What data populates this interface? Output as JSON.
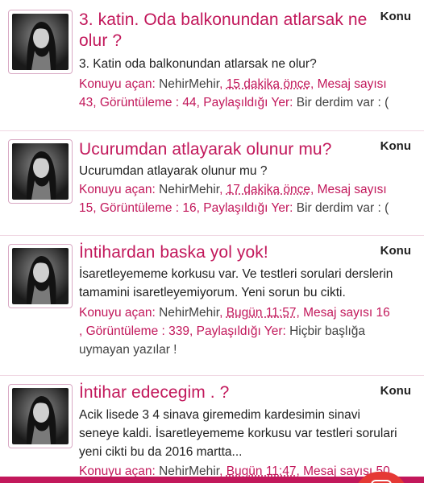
{
  "posts": [
    {
      "title_line1": "3. katin. Oda balkonundan atlarsak ne",
      "title_line2": "olur ?",
      "badge": "Konu",
      "snippet": "3. Katin oda balkonundan atlarsak ne olur?",
      "meta": {
        "opener_label": "Konuyu açan: ",
        "opener_name": "NehirMehir",
        "sep": ", ",
        "time": "15 dakika önce",
        "msg_label": ", Mesaj sayısı",
        "msg_count": "43",
        "views_label": ", Görüntüleme : ",
        "views": "44",
        "share_label": ", Paylaşıldığı Yer: ",
        "share_place": "Bir derdim var : ("
      }
    },
    {
      "title_line1": "Ucurumdan atlayarak olunur mu?",
      "badge": "Konu",
      "snippet": "Ucurumdan atlayarak olunur mu ?",
      "meta": {
        "opener_label": "Konuyu açan: ",
        "opener_name": "NehirMehir",
        "sep": ", ",
        "time": "17 dakika önce",
        "msg_label": ", Mesaj sayısı",
        "msg_count": "15",
        "views_label": ", Görüntüleme : ",
        "views": "16",
        "share_label": ", Paylaşıldığı Yer: ",
        "share_place": "Bir derdim var : ("
      }
    },
    {
      "title_line1": "İntihardan baska yol yok!",
      "badge": "Konu",
      "snippet_line1": "İsaretleyememe korkusu var. Ve testleri sorulari derslerin",
      "snippet_line2": "tamamini isaretleyemiyorum. Yeni sorun bu cikti.",
      "meta": {
        "opener_label": "Konuyu açan: ",
        "opener_name": "NehirMehir",
        "sep": ", ",
        "time": "Bugün 11:57",
        "msg_label": ", Mesaj sayısı ",
        "msg_count": "16",
        "views_label": ", Görüntüleme : ",
        "views": "339",
        "share_label": ", Paylaşıldığı Yer: ",
        "share_place_line1": "Hiçbir başlığa",
        "share_place_line2": "uymayan yazılar !"
      }
    },
    {
      "title_line1": "İntihar edecegim . ?",
      "badge": "Konu",
      "snippet_line1": "Acik lisede 3 4 sinava giremedim kardesimin sinavi",
      "snippet_line2": "seneye kaldi. İsaretleyememe korkusu var testleri sorulari",
      "snippet_line3": "yeni cikti bu da 2016 martta...",
      "meta": {
        "opener_label": "Konuyu açan: ",
        "opener_name": "NehirMehir",
        "sep": ", ",
        "time": "Bugün 11:47",
        "msg_label": ", Mesaj sayısı ",
        "msg_count": "50"
      }
    }
  ],
  "colors": {
    "accent": "#c2185b",
    "text": "#212121",
    "fab": "#e53935"
  },
  "icons": {
    "avatar": "user-avatar-photo",
    "fab": "fab-icon"
  }
}
